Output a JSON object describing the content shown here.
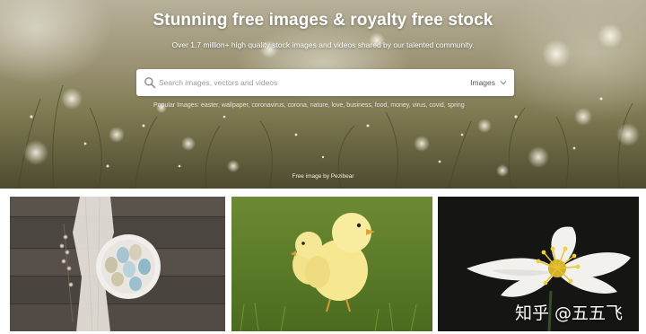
{
  "hero": {
    "title": "Stunning free images & royalty free stock",
    "subtitle": "Over 1.7 million+ high quality stock images and videos shared by our talented community.",
    "credit": "Free image by Pezibear"
  },
  "search": {
    "placeholder": "Search images, vectors and videos",
    "type_selected": "Images",
    "icon": "search-icon"
  },
  "popular": {
    "label": "Popular Images:",
    "tags": [
      "easter",
      "wallpaper",
      "coronavirus",
      "corona",
      "nature",
      "love",
      "business",
      "food",
      "money",
      "virus",
      "covid",
      "spring"
    ]
  },
  "watermark": "知乎 @五五飞",
  "colors": {
    "hero_text": "#ffffff",
    "search_bg": "#ffffff",
    "page_bg": "#ffffff"
  }
}
